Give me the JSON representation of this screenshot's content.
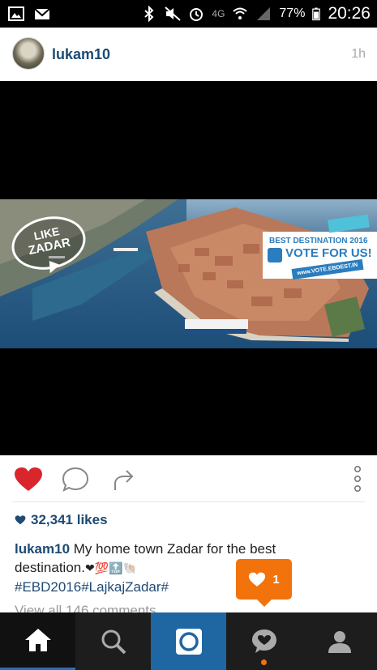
{
  "status_bar": {
    "network": "4G",
    "battery": "77%",
    "time": "20:26",
    "icons": [
      "gallery-icon",
      "mail-icon",
      "bluetooth-icon",
      "mute-icon",
      "alarm-icon",
      "wifi-icon",
      "signal-icon",
      "battery-icon"
    ]
  },
  "post": {
    "username": "lukam10",
    "time_ago": "1h",
    "likes": "32,341 likes",
    "caption_user": "lukam10",
    "caption_text": " My home town Zadar for the best destination.",
    "caption_emojis": "❤💯🔝🐚",
    "hashtags": "#EBD2016#LajkajZadar#",
    "view_comments": "View all 146 comments"
  },
  "image": {
    "bubble_line1": "LIKE",
    "bubble_line2": "ZADAR",
    "banner_title": "BEST DESTINATION 2016",
    "banner_cta": "VOTE FOR US!",
    "banner_url": "www.VOTE.EBDEST.IN"
  },
  "notification": {
    "count": "1",
    "icon": "heart-icon"
  },
  "nav": [
    "home-icon",
    "search-icon",
    "camera-icon",
    "activity-icon",
    "profile-icon"
  ],
  "colors": {
    "accent_blue": "#1e4a74",
    "like_red": "#d9262d",
    "orange": "#f2730b"
  }
}
